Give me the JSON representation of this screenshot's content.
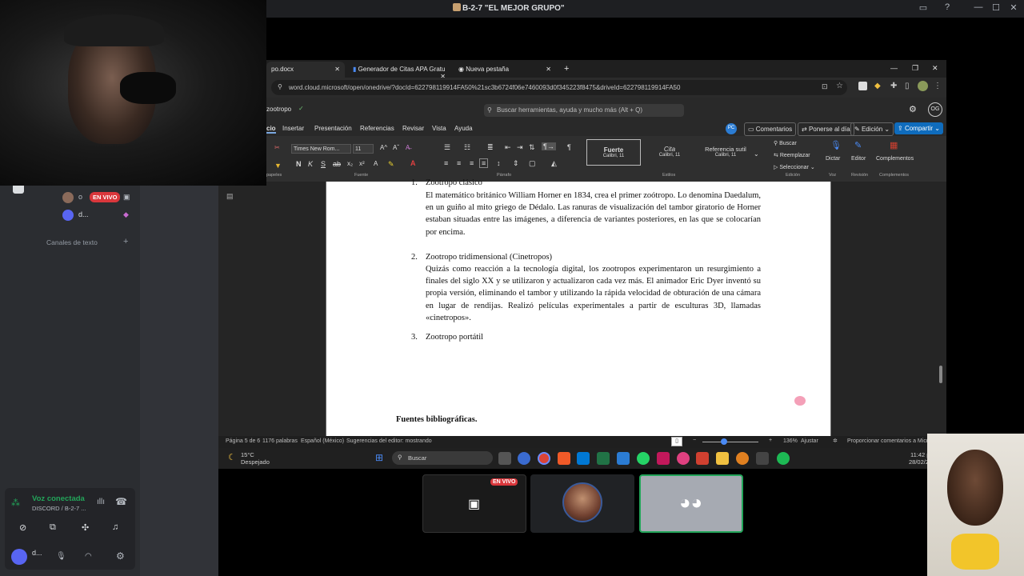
{
  "discord_topbar": {
    "title": "B-2-7 \"EL MEJOR GRUPO\"",
    "controls": [
      "—",
      "☐",
      "✕"
    ]
  },
  "discord_sidebar": {
    "live_badge": "EN VIVO",
    "user1": "o",
    "user2": "d...",
    "text_channels": "Canales de texto",
    "add": "+",
    "voice_status": "Voz conectada",
    "voice_channel": "DISCORD / B-2-7 ...",
    "username": "d..."
  },
  "browser": {
    "tabs": [
      {
        "label": "po.docx",
        "active": true
      },
      {
        "label": "Generador de Citas APA Gratu",
        "active": false
      },
      {
        "label": "Nueva pestaña",
        "active": false
      }
    ],
    "new_tab": "+",
    "url": "word.cloud.microsoft/open/onedrive/?docId=622798119914FA50%21sc3b6724f06e7460093d0f345223f8475&driveId=622798119914FA50",
    "window_controls": [
      "—",
      "❐",
      "✕"
    ]
  },
  "word": {
    "filename": "zootropo",
    "search_placeholder": "Buscar herramientas, ayuda y mucho más (Alt + Q)",
    "user_initials": "OG",
    "menu": [
      "cio",
      "Insertar",
      "Presentación",
      "Referencias",
      "Revisar",
      "Vista",
      "Ayuda"
    ],
    "pc_initials": "PC",
    "comments_btn": "Comentarios",
    "catchup_btn": "Ponerse al día",
    "edit_btn": "Edición",
    "share_btn": "Compartir",
    "font_name": "Times New Rom...",
    "font_size": "11",
    "styles": [
      {
        "name": "Fuerte",
        "sub": "Calibri, 11"
      },
      {
        "name": "Cita",
        "sub": "Calibri, 11"
      },
      {
        "name": "Referencia sutil",
        "sub": "Calibri, 11"
      }
    ],
    "find_items": [
      "Buscar",
      "Reemplazar",
      "Seleccionar"
    ],
    "dictate": "Dictar",
    "editor": "Editor",
    "addins": "Complementos",
    "group_labels": [
      "papeles",
      "Fuente",
      "Párrafo",
      "Estilos",
      "Edición",
      "Voz",
      "Revisión",
      "Complementos"
    ]
  },
  "document": {
    "item1_num": "1.",
    "item1_title": "Zootropo clásico",
    "item1_body": "El matemático británico William Horner en 1834, crea el primer zoótropo. Lo denomina Daedalum, en un guiño al mito griego de Dédalo. Las ranuras de visualización del tambor giratorio de Horner estaban situadas entre las imágenes, a diferencia de variantes posteriores, en las que se colocarían por encima.",
    "item2_num": "2.",
    "item2_title": "Zootropo tridimensional (Cinetropos)",
    "item2_body": "Quizás como reacción a la tecnología digital, los zootropos experimentaron un resurgimiento a finales del siglo XX y se utilizaron y actualizaron cada vez más. El animador Eric Dyer inventó su propia versión, eliminando el tambor y utilizando la rápida velocidad de obturación de una cámara en lugar de rendijas. Realizó películas experimentales a partir de esculturas 3D, llamadas «cinetropos».",
    "item3_num": "3.",
    "item3_title": "Zootropo portátil",
    "sources": "Fuentes bibliográficas."
  },
  "status": {
    "page": "Página 5 de 6",
    "words": "1176 palabras",
    "lang": "Español (México)",
    "suggestions": "Sugerencias del editor: mostrando",
    "zoom": "136%",
    "fit": "Ajustar",
    "feedback": "Proporcionar comentarios a Micr"
  },
  "taskbar": {
    "temp": "15°C",
    "weather": "Despejado",
    "search": "Buscar",
    "time": "11:42 p",
    "date": "28/02/2"
  },
  "streams": {
    "live_badge": "EN VIVO"
  },
  "colors": {
    "discord_green": "#23a55a",
    "live_red": "#da373c",
    "word_blue": "#2b7cd3",
    "share_blue": "#0f6cbd"
  }
}
